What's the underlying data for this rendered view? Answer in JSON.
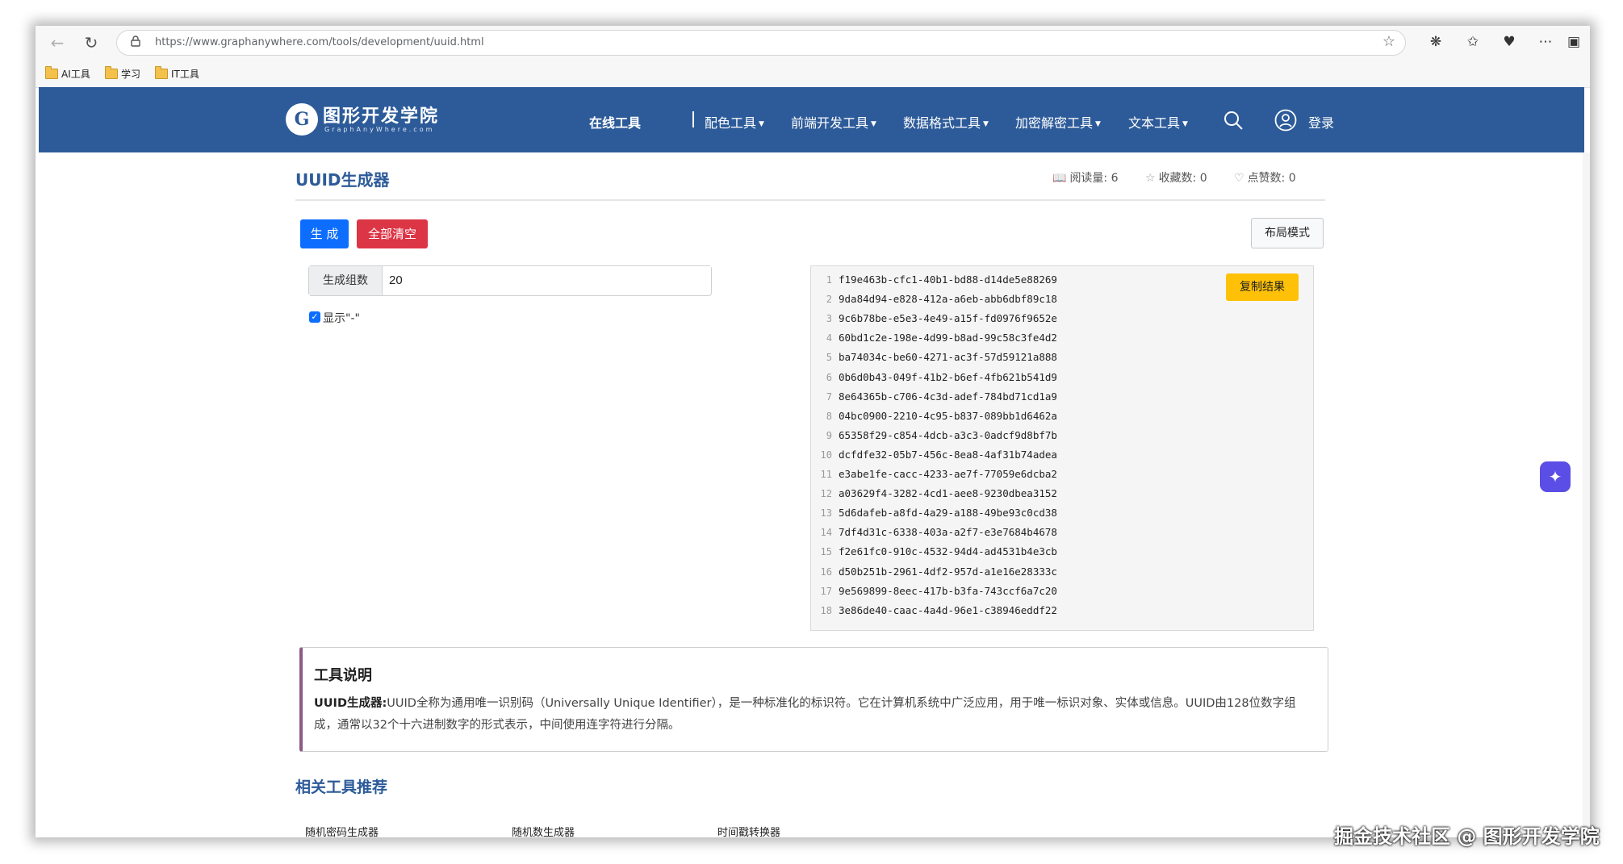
{
  "browser": {
    "url": "https://www.graphanywhere.com/tools/development/uuid.html",
    "bookmarks": [
      "AI工具",
      "学习",
      "IT工具"
    ]
  },
  "site": {
    "logo_letter": "G",
    "name": "图形开发学院",
    "subtitle": "GraphAnyWhere.com",
    "nav": {
      "online_tools": "在线工具",
      "color_tools": "配色工具",
      "frontend_tools": "前端开发工具",
      "data_format_tools": "数据格式工具",
      "crypto_tools": "加密解密工具",
      "text_tools": "文本工具",
      "login": "登录"
    }
  },
  "page": {
    "title": "UUID生成器",
    "stats": {
      "reads_label": "阅读量:",
      "reads_value": "6",
      "favorites_label": "收藏数:",
      "favorites_value": "0",
      "likes_label": "点赞数:",
      "likes_value": "0"
    },
    "buttons": {
      "generate": "生 成",
      "clear_all": "全部清空",
      "layout_mode": "布局模式",
      "copy_result": "复制结果"
    },
    "count_label": "生成组数",
    "count_value": "20",
    "show_dash_label": "显示\"-\"",
    "show_dash_checked": true,
    "results": [
      "f19e463b-cfc1-40b1-bd88-d14de5e88269",
      "9da84d94-e828-412a-a6eb-abb6dbf89c18",
      "9c6b78be-e5e3-4e49-a15f-fd0976f9652e",
      "60bd1c2e-198e-4d99-b8ad-99c58c3fe4d2",
      "ba74034c-be60-4271-ac3f-57d59121a888",
      "0b6d0b43-049f-41b2-b6ef-4fb621b541d9",
      "8e64365b-c706-4c3d-adef-784bd71cd1a9",
      "04bc0900-2210-4c95-b837-089bb1d6462a",
      "65358f29-c854-4dcb-a3c3-0adcf9d8bf7b",
      "dcfdfe32-05b7-456c-8ea8-4af31b74adea",
      "e3abe1fe-cacc-4233-ae7f-77059e6dcba2",
      "a03629f4-3282-4cd1-aee8-9230dbea3152",
      "5d6dafeb-a8fd-4a29-a188-49be93c0cd38",
      "7df4d31c-6338-403a-a2f7-e3e7684b4678",
      "f2e61fc0-910c-4532-94d4-ad4531b4e3cb",
      "d50b251b-2961-4df2-957d-a1e16e28333c",
      "9e569899-8eec-417b-b3fa-743ccf6a7c20",
      "3e86de40-caac-4a4d-96e1-c38946eddf22"
    ],
    "description": {
      "title": "工具说明",
      "lead": "UUID生成器:",
      "text": "UUID全称为通用唯一识别码（Universally Unique Identifier），是一种标准化的标识符。它在计算机系统中广泛应用，用于唯一标识对象、实体或信息。UUID由128位数字组成，通常以32个十六进制数字的形式表示，中间使用连字符进行分隔。"
    },
    "related": {
      "title": "相关工具推荐",
      "items": [
        "随机密码生成器",
        "随机数生成器",
        "时间戳转换器"
      ]
    }
  },
  "watermark": "掘金技术社区 @ 图形开发学院"
}
